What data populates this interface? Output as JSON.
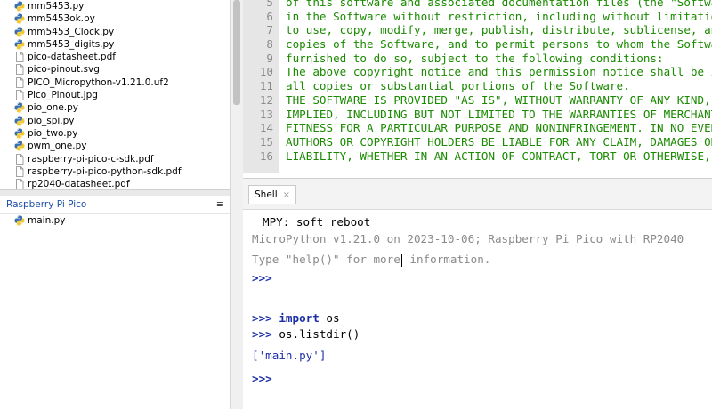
{
  "files": [
    {
      "name": "mm5453.py",
      "type": "python"
    },
    {
      "name": "mm5453ok.py",
      "type": "python"
    },
    {
      "name": "mm5453_Clock.py",
      "type": "python"
    },
    {
      "name": "mm5453_digits.py",
      "type": "python"
    },
    {
      "name": "pico-datasheet.pdf",
      "type": "doc"
    },
    {
      "name": "pico-pinout.svg",
      "type": "doc"
    },
    {
      "name": "PICO_Micropython-v1.21.0.uf2",
      "type": "doc"
    },
    {
      "name": "Pico_Pinout.jpg",
      "type": "doc"
    },
    {
      "name": "pio_one.py",
      "type": "python"
    },
    {
      "name": "pio_spi.py",
      "type": "python"
    },
    {
      "name": "pio_two.py",
      "type": "python"
    },
    {
      "name": "pwm_one.py",
      "type": "python"
    },
    {
      "name": "raspberry-pi-pico-c-sdk.pdf",
      "type": "doc"
    },
    {
      "name": "raspberry-pi-pico-python-sdk.pdf",
      "type": "doc"
    },
    {
      "name": "rp2040-datasheet.pdf",
      "type": "doc"
    }
  ],
  "device_panel": {
    "title": "Raspberry Pi Pico",
    "menu_icon": "≡",
    "files": [
      {
        "name": "main.py",
        "type": "python"
      }
    ]
  },
  "editor": {
    "lines": [
      {
        "num": "5",
        "text": "of this software and associated documentation files (the \"Softwa"
      },
      {
        "num": "6",
        "text": "in the Software without restriction, including without limitatio"
      },
      {
        "num": "7",
        "text": "to use, copy, modify, merge, publish, distribute, sublicense, an"
      },
      {
        "num": "8",
        "text": "copies of the Software, and to permit persons to whom the Softwa"
      },
      {
        "num": "9",
        "text": "furnished to do so, subject to the following conditions:"
      },
      {
        "num": "10",
        "text": "The above copyright notice and this permission notice shall be i"
      },
      {
        "num": "11",
        "text": "all copies or substantial portions of the Software."
      },
      {
        "num": "12",
        "text": "THE SOFTWARE IS PROVIDED \"AS IS\", WITHOUT WARRANTY OF ANY KIND,"
      },
      {
        "num": "13",
        "text": "IMPLIED, INCLUDING BUT NOT LIMITED TO THE WARRANTIES OF MERCHANT"
      },
      {
        "num": "14",
        "text": "FITNESS FOR A PARTICULAR PURPOSE AND NONINFRINGEMENT. IN NO EVEN"
      },
      {
        "num": "15",
        "text": "AUTHORS OR COPYRIGHT HOLDERS BE LIABLE FOR ANY CLAIM, DAMAGES OR"
      },
      {
        "num": "16",
        "text": "LIABILITY, WHETHER IN AN ACTION OF CONTRACT, TORT OR OTHERWISE,"
      }
    ]
  },
  "shell": {
    "tab_label": "Shell",
    "tab_close": "×",
    "soft_reboot": "MPY: soft reboot",
    "banner": "MicroPython v1.21.0 on 2023-10-06; Raspberry Pi Pico with RP2040",
    "help_before": "Type \"help()\" for more",
    "help_after": " information.",
    "prompt": ">>>",
    "import_kw": "import",
    "import_mod": " os",
    "listdir_cmd": " os.listdir()",
    "listdir_result": "['main.py']"
  },
  "colors": {
    "code_text": "#1a8a00",
    "prompt": "#1c2ea8",
    "grey_text": "#8a8a8a",
    "device_title": "#1c4fa5"
  }
}
